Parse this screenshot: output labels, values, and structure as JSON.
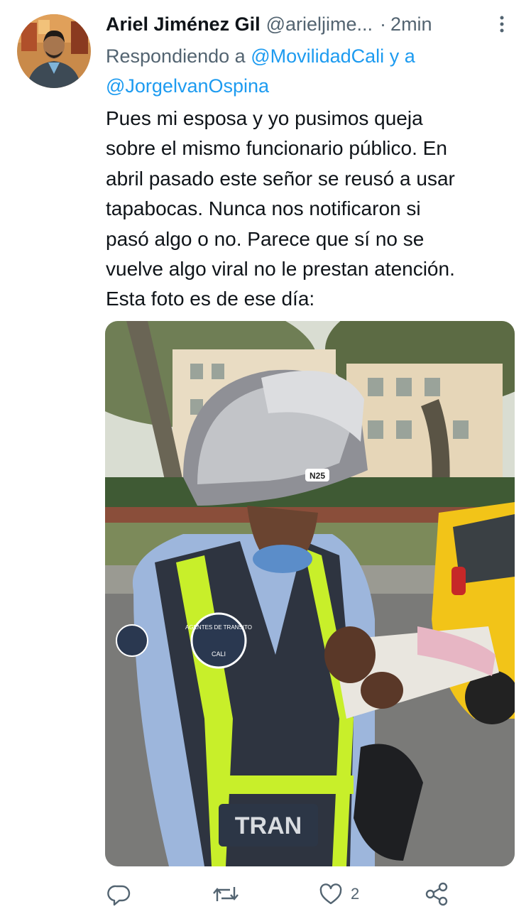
{
  "author": {
    "name": "Ariel Jiménez Gil",
    "handle": "@arieljime...",
    "separator": "·",
    "time": "2min"
  },
  "reply_to": {
    "prefix": "Respondiendo a",
    "mention_1": "@MovilidadCali",
    "connector": "y a",
    "mention_2": "@JorgelvanOspina"
  },
  "tweet": {
    "lines": [
      "Pues mi esposa y yo pusimos queja",
      "sobre el mismo funcionario público. En",
      "abril pasado este señor se reusó a usar",
      "tapabocas. Nunca nos notificaron si",
      "pasó algo o no. Parece que sí no se",
      "vuelve algo viral no le prestan atención.",
      "Esta foto es de ese día:"
    ]
  },
  "media": {
    "vest_text": "TRAN",
    "helmet_text": "N25",
    "patch_line_1": "AGENTES DE TRANSITO",
    "patch_line_2": "CALI"
  },
  "actions": {
    "reply_icon": "reply-icon",
    "retweet_icon": "retweet-icon",
    "like_icon": "heart-icon",
    "like_count": "2",
    "share_icon": "share-icon"
  },
  "colors": {
    "text": "#0f1419",
    "muted": "#536471",
    "link": "#1d9bf0"
  }
}
